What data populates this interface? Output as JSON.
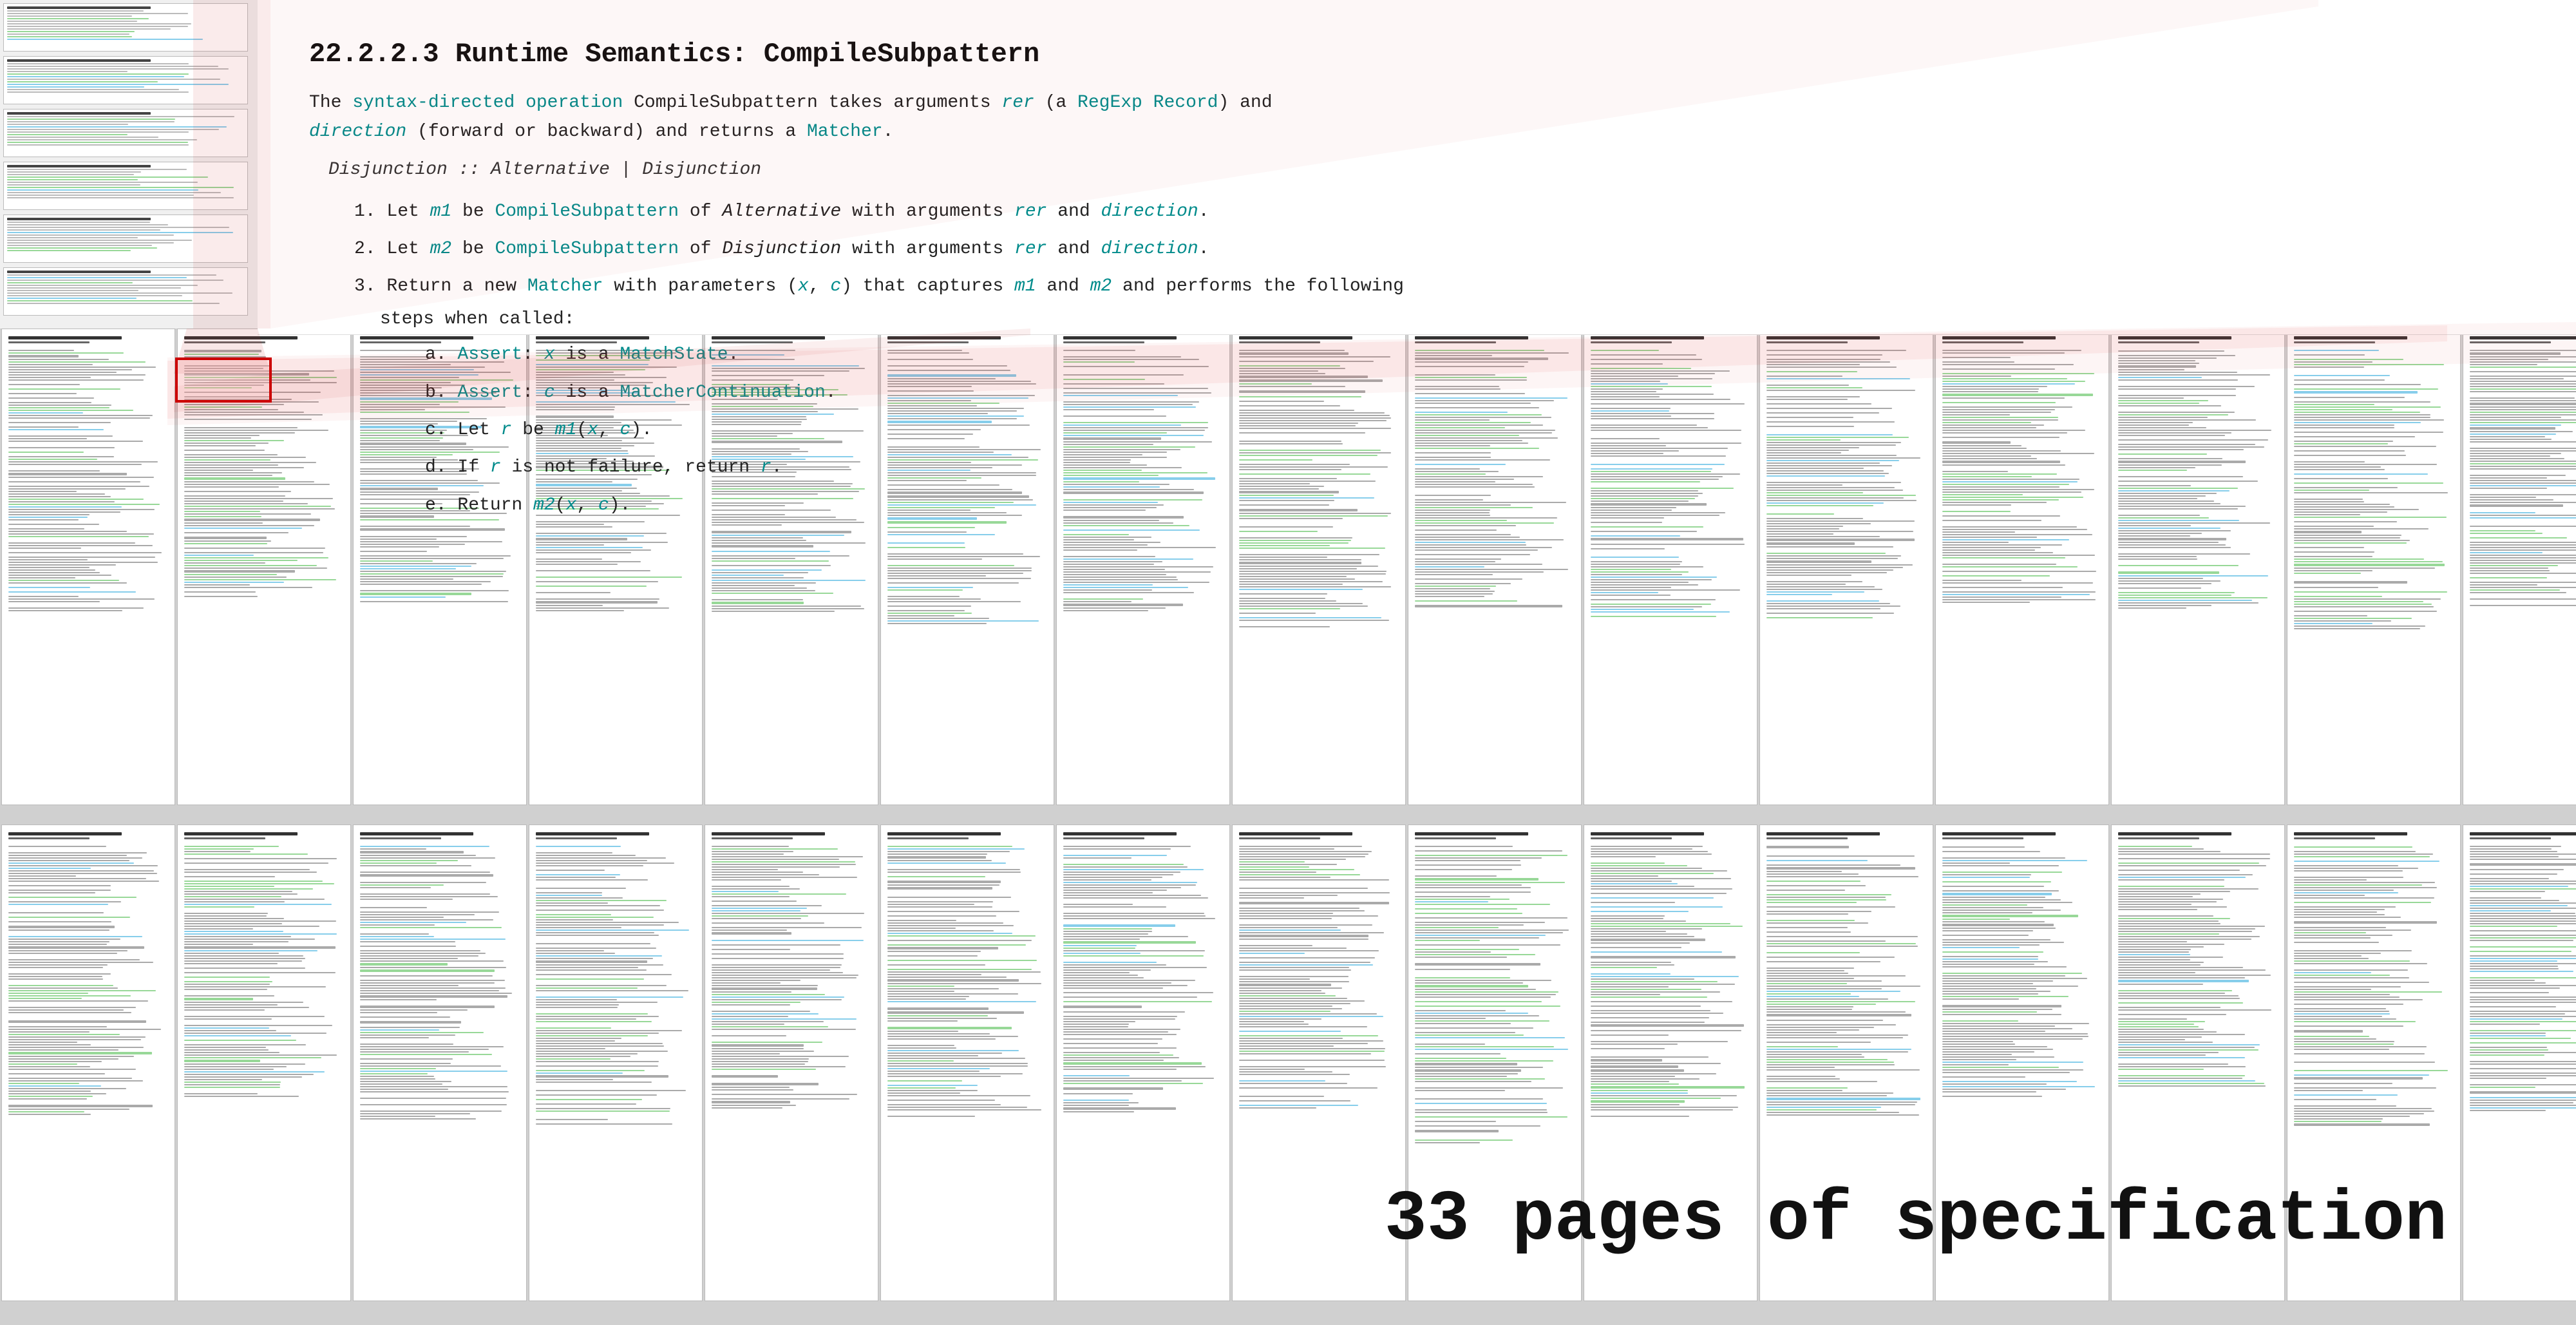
{
  "section": {
    "title": "22.2.2.3 Runtime Semantics: CompileSubpattern",
    "intro": {
      "text1": "The ",
      "link1": "syntax-directed operation",
      "text2": " CompileSubpattern takes arguments ",
      "italic1": "rer",
      "text3": " (a ",
      "link2": "RegExp Record",
      "text4": ") and",
      "text5": "",
      "italic2": "direction",
      "text6": " (forward or backward) and returns a ",
      "link3": "Matcher",
      "text7": "."
    },
    "grammar": "Disjunction  ::  Alternative  |  Disjunction",
    "steps": [
      {
        "num": "1.",
        "text": "Let ",
        "italic": "m1",
        "rest": " be CompileSubpattern of ",
        "italic2": "Alternative",
        "rest2": " with arguments ",
        "italic3": "rer",
        "rest3": " and ",
        "italic4": "direction",
        "rest4": "."
      },
      {
        "num": "2.",
        "text": "Let ",
        "italic": "m2",
        "rest": " be CompileSubpattern of ",
        "italic2": "Disjunction",
        "rest2": " with arguments ",
        "italic3": "rer",
        "rest3": " and ",
        "italic4": "direction",
        "rest4": "."
      },
      {
        "num": "3.",
        "text": "Return a new Matcher with parameters (",
        "italic": "x",
        "rest": ", ",
        "italic2": "c",
        "rest2": ") that captures ",
        "italic3": "m1",
        "rest3": " and ",
        "italic4": "m2",
        "rest4": " and performs the following steps when called:"
      }
    ],
    "substeps": [
      {
        "letter": "a.",
        "text": "Assert: ",
        "italic": "x",
        "rest": " is a MatchState."
      },
      {
        "letter": "b.",
        "text": "Assert: ",
        "italic": "c",
        "rest": " is a MatcherContinuation."
      },
      {
        "letter": "c.",
        "text": "Let ",
        "italic": "r",
        "rest": " be ",
        "italic2": "m1",
        "rest2": "(",
        "italic3": "x",
        "rest3": ", ",
        "italic4": "c",
        "rest4": ")."
      },
      {
        "letter": "d.",
        "text": "If ",
        "italic": "r",
        "rest": " is not failure, return ",
        "italic2": "r",
        "rest2": "."
      },
      {
        "letter": "e.",
        "text": "Return ",
        "italic": "m2",
        "rest": "(",
        "italic2": "x",
        "rest2": ", ",
        "italic3": "c",
        "rest3": ")."
      }
    ]
  },
  "big_label": "33 pages of specification",
  "colors": {
    "cyan": "#008b8b",
    "blue": "#0000cd",
    "red": "#cc0000",
    "beam_pink": "rgba(220,80,80,0.15)"
  }
}
